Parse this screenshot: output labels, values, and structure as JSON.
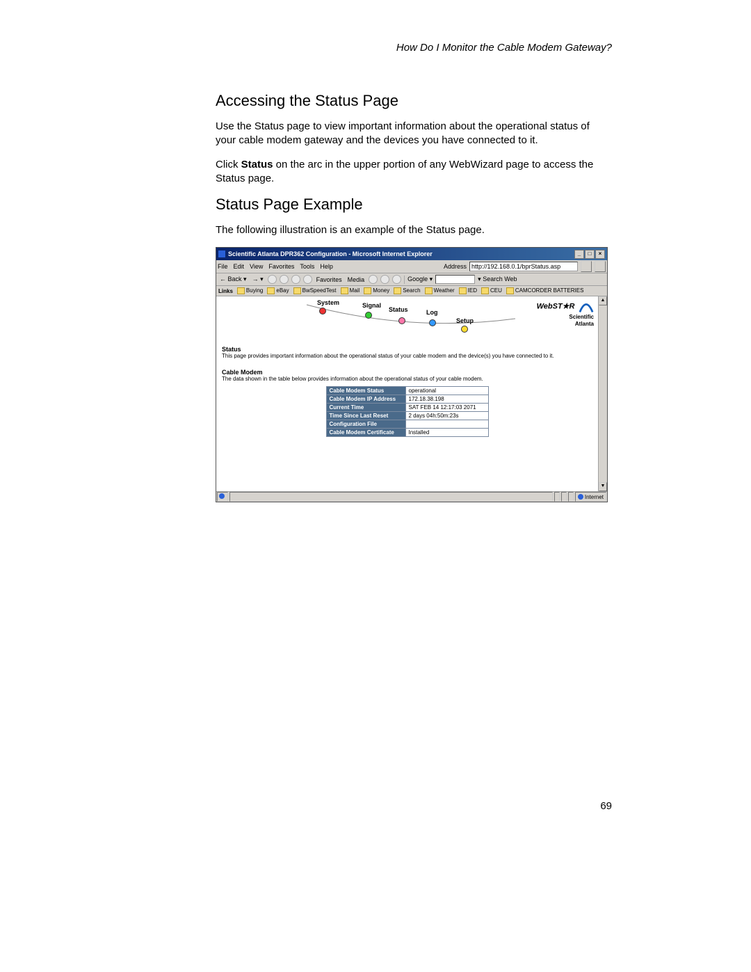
{
  "running_head": "How Do I Monitor the Cable Modem Gateway?",
  "h_accessing": "Accessing the Status Page",
  "p_intro": "Use the Status page to view important information about the operational status of your cable modem gateway and the devices you have connected to it.",
  "p_click_pre": "Click ",
  "p_click_bold": "Status",
  "p_click_post": " on the arc in the upper portion of any WebWizard page to access the Status page.",
  "h_example": "Status Page Example",
  "p_example": "The following illustration is an example of the Status page.",
  "page_number": "69",
  "ie": {
    "title": "Scientific Atlanta DPR362 Configuration - Microsoft Internet Explorer",
    "win_min": "_",
    "win_max": "□",
    "win_close": "×",
    "menu": [
      "File",
      "Edit",
      "View",
      "Favorites",
      "Tools",
      "Help"
    ],
    "address_label": "Address",
    "address_value": "http://192.168.0.1/bprStatus.asp",
    "back": "Back",
    "favorites": "Favorites",
    "media": "Media",
    "google": "Google ▾",
    "search_web": "Search Web",
    "links_label": "Links",
    "links": [
      "Buying",
      "eBay",
      "BwSpeedTest",
      "Mail",
      "Money",
      "Search",
      "Weather",
      "IED",
      "CEU",
      "CAMCORDER BATTERIES"
    ],
    "arc": {
      "system": "System",
      "signal": "Signal",
      "status": "Status",
      "log": "Log",
      "setup": "Setup"
    },
    "brand_webstar": "WebST★R",
    "brand_sa1": "Scientific",
    "brand_sa2": "Atlanta",
    "s_head": "Status",
    "s_desc": "This page provides important information about the operational status of your cable modem and the device(s) you have connected to it.",
    "cm_head": "Cable Modem",
    "cm_desc": "The data shown in the table below provides information about the operational status of your cable modem.",
    "table": [
      {
        "k": "Cable Modem Status",
        "v": "operational"
      },
      {
        "k": "Cable Modem IP Address",
        "v": "172.18.38.198"
      },
      {
        "k": "Current Time",
        "v": "SAT FEB 14 12:17:03 2071"
      },
      {
        "k": "Time Since Last Reset",
        "v": "2 days 04h:50m:23s"
      },
      {
        "k": "Configuration File",
        "v": ""
      },
      {
        "k": "Cable Modem Certificate",
        "v": "Installed"
      }
    ],
    "status_internet": "Internet"
  }
}
